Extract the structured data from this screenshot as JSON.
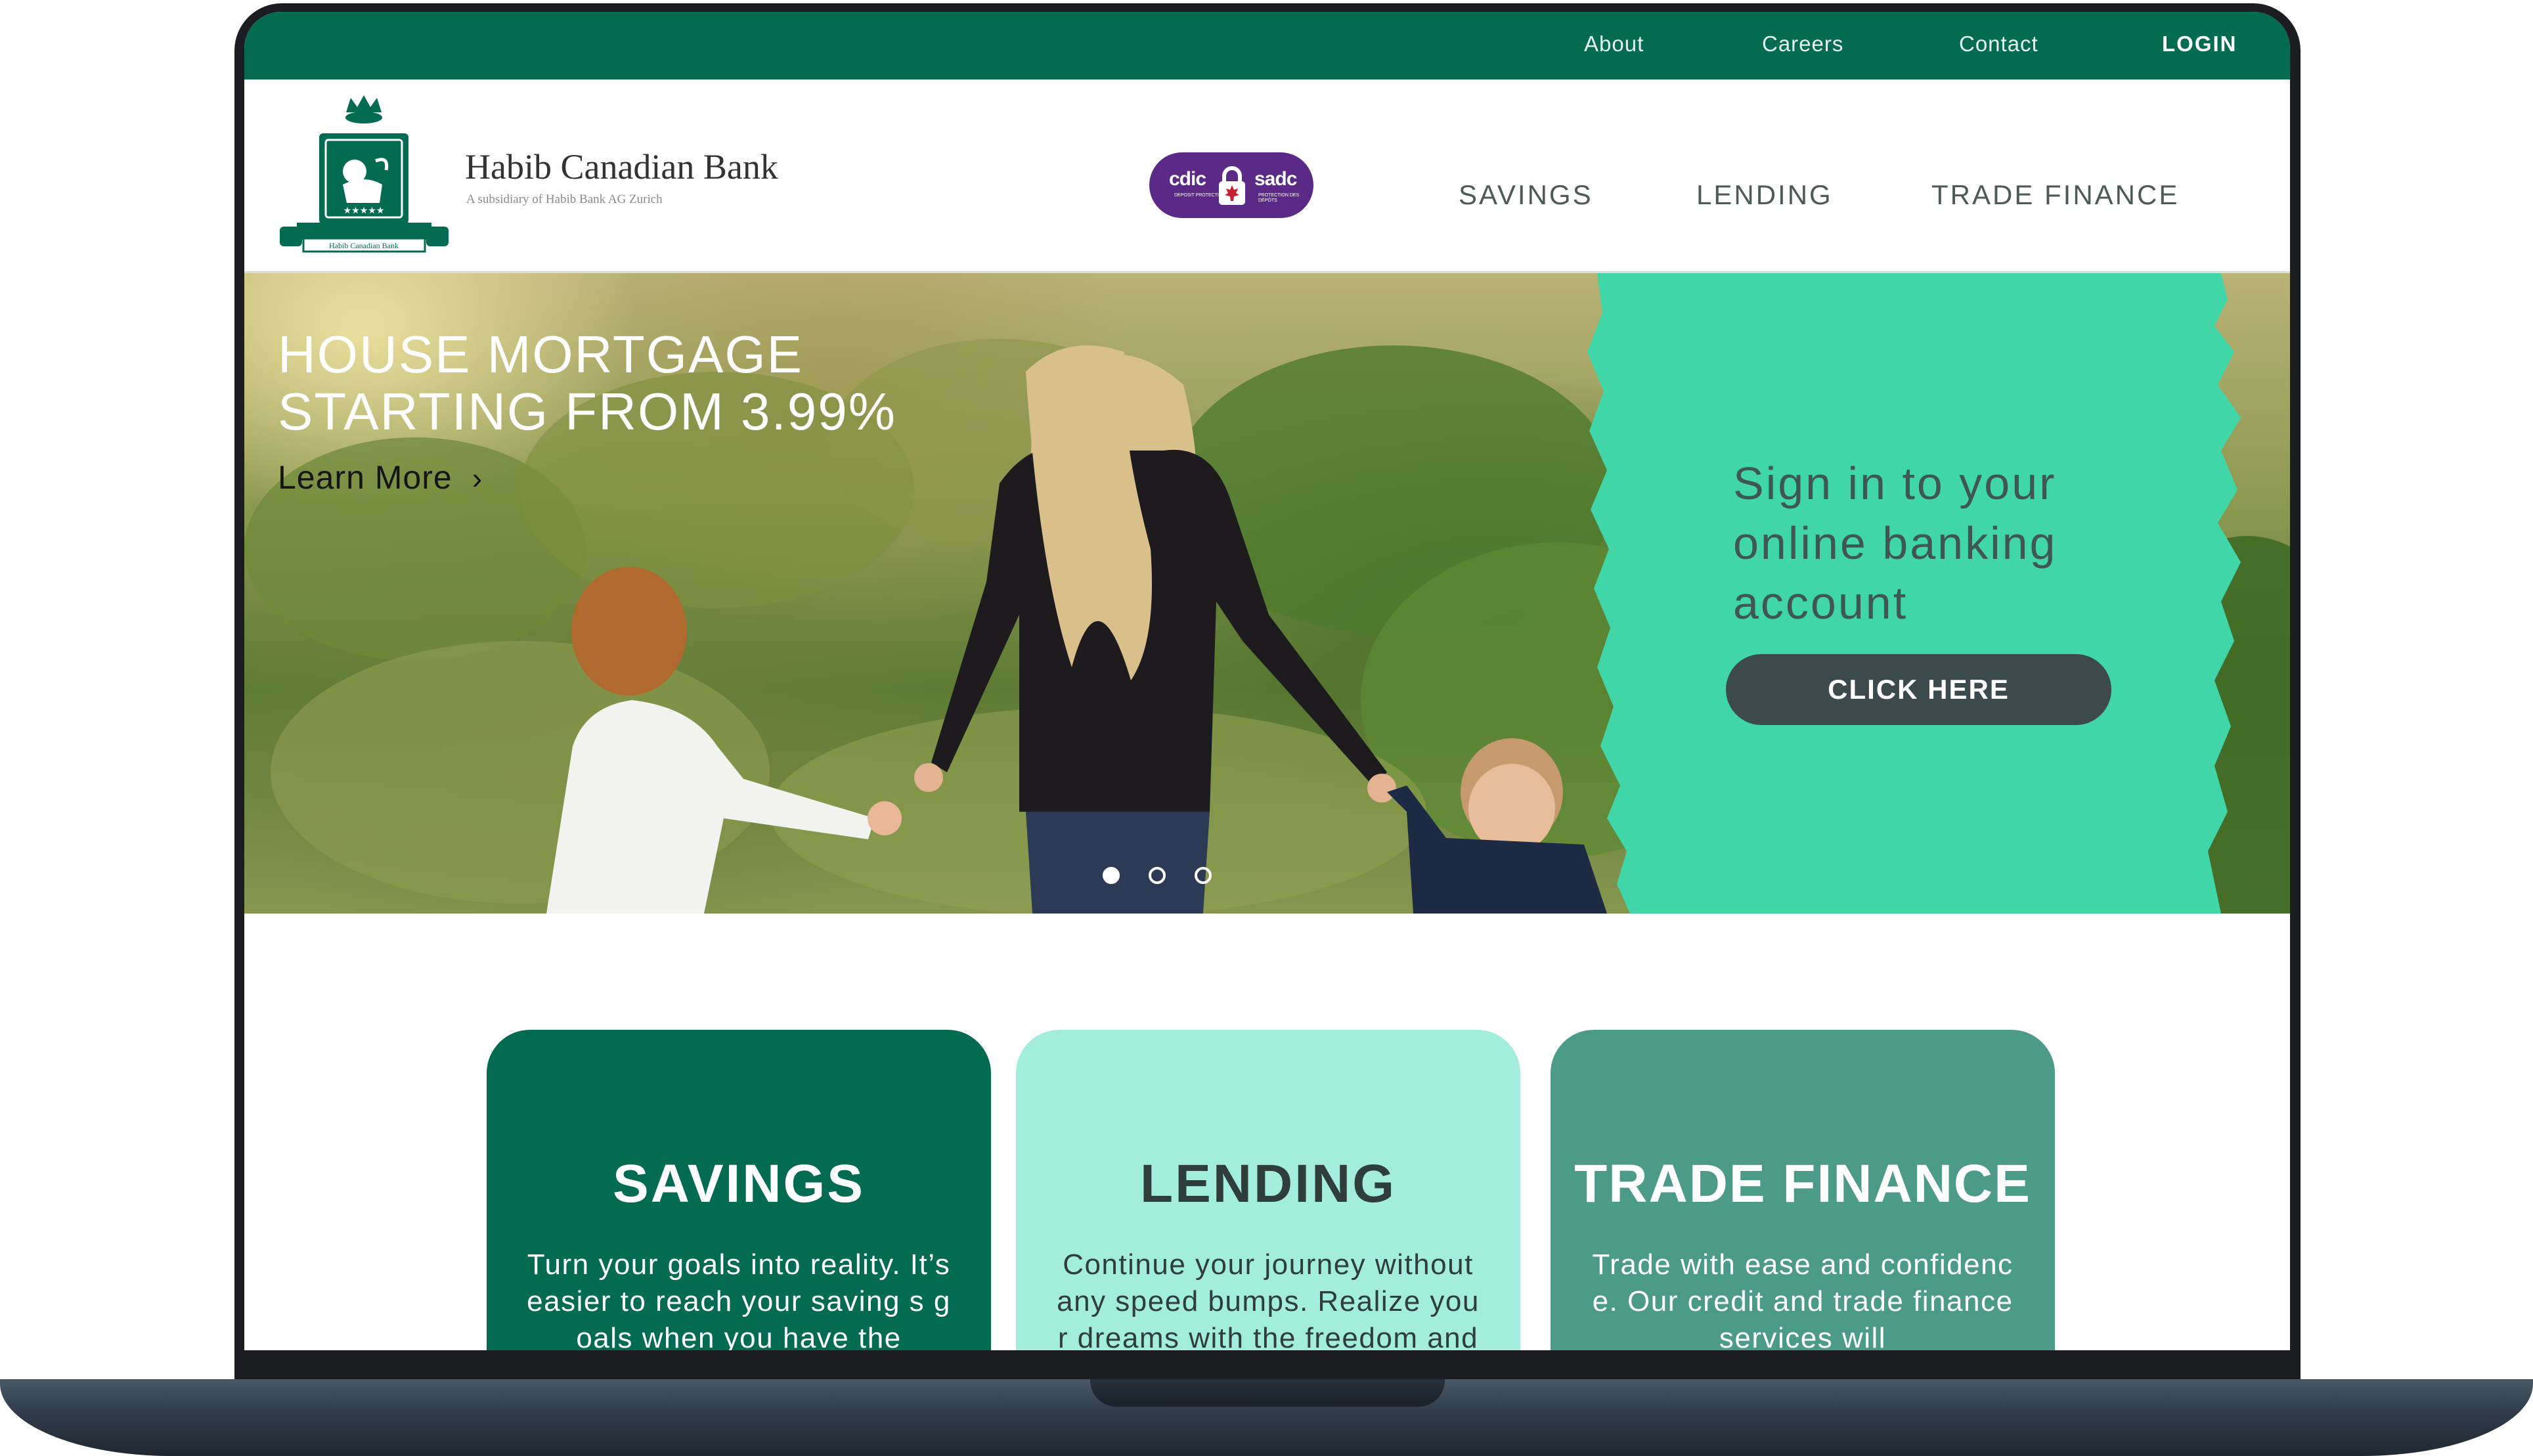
{
  "topbar": {
    "links": [
      "About",
      "Careers",
      "Contact"
    ],
    "login": "LOGIN"
  },
  "brand": {
    "name": "Habib Canadian Bank",
    "tagline": "A subsidiary of Habib Bank AG Zurich",
    "emblem_text": "Habib Canadian Bank"
  },
  "badge": {
    "left_word": "cdic",
    "right_word": "sadc",
    "left_caption": "DEPOSIT PROTECTION",
    "right_caption": "PROTECTION DES DÉPÔTS"
  },
  "nav": [
    "SAVINGS",
    "LENDING",
    "TRADE FINANCE"
  ],
  "hero": {
    "promo_line1": "HOUSE MORTGAGE",
    "promo_line2": "STARTING FROM 3.99%",
    "learn_more": "Learn More",
    "signin_text": "Sign in to your online banking account",
    "cta": "CLICK HERE",
    "slide_count": 3,
    "active_slide": 1
  },
  "cards": [
    {
      "title": "SAVINGS",
      "text": "Turn your goals into reality. It’s easier to reach your saving s goals when you have the"
    },
    {
      "title": "LENDING",
      "text": "Continue your journey without any speed bumps. Realize your dreams with the freedom and"
    },
    {
      "title": "TRADE FINANCE",
      "text": "Trade with ease and confidence. Our credit and trade finance services will"
    }
  ],
  "colors": {
    "primary_green": "#036b52",
    "mint": "#40d6a8",
    "light_mint": "#a2eddc",
    "teal": "#4c9a88",
    "badge_purple": "#5b2a86",
    "button_dark": "#3d4a4b"
  },
  "icons": {
    "learn_more": "chevron-right-icon",
    "badge_lock": "maple-leaf-lock-icon",
    "logo": "lion-crest-icon"
  }
}
